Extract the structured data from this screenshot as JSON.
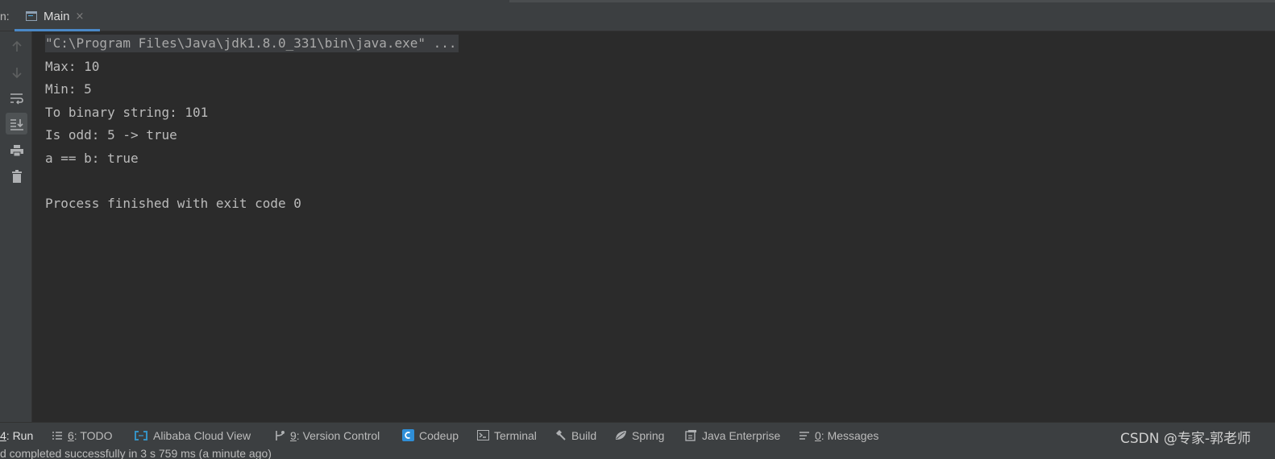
{
  "header": {
    "prefix": "n:",
    "tab": {
      "label": "Main",
      "close": "×"
    }
  },
  "toolbar": {
    "icons": [
      "arrow-up-icon",
      "arrow-down-icon",
      "soft-wrap-icon",
      "scroll-to-end-icon",
      "print-icon",
      "trash-icon"
    ]
  },
  "console": {
    "lines": [
      "\"C:\\Program Files\\Java\\jdk1.8.0_331\\bin\\java.exe\" ...",
      "Max: 10",
      "Min: 5",
      "To binary string: 101",
      "Is odd: 5 -> true",
      "a == b: true",
      "",
      "Process finished with exit code 0"
    ]
  },
  "bottom_tabs": [
    {
      "num": "4",
      "label": ": Run",
      "icon": "run-icon"
    },
    {
      "num": "6",
      "label": ": TODO",
      "icon": "list-icon"
    },
    {
      "num": "",
      "label": "Alibaba Cloud View",
      "icon": "alibaba-cloud-icon"
    },
    {
      "num": "9",
      "label": ": Version Control",
      "icon": "version-control-icon"
    },
    {
      "num": "",
      "label": "Codeup",
      "icon": "codeup-icon"
    },
    {
      "num": "",
      "label": "Terminal",
      "icon": "terminal-icon"
    },
    {
      "num": "",
      "label": "Build",
      "icon": "hammer-icon"
    },
    {
      "num": "",
      "label": "Spring",
      "icon": "spring-leaf-icon"
    },
    {
      "num": "",
      "label": "Java Enterprise",
      "icon": "java-enterprise-icon"
    },
    {
      "num": "0",
      "label": ": Messages",
      "icon": "messages-icon"
    }
  ],
  "watermark": "CSDN @专家-郭老师",
  "status": {
    "text": "d completed successfully in 3 s 759 ms (a minute ago)"
  },
  "colors": {
    "background": "#2b2b2b",
    "panel": "#3c3f41",
    "accent": "#4a88c7",
    "text": "#bbbbbb"
  }
}
